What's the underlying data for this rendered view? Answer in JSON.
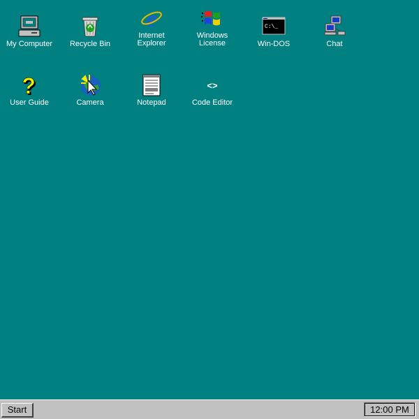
{
  "desktop": {
    "background": "#008080",
    "icons": [
      {
        "label": "My Computer",
        "icon": "computer-icon"
      },
      {
        "label": "Recycle Bin",
        "icon": "recycle-bin-icon"
      },
      {
        "label": "Internet\nExplorer",
        "icon": "internet-explorer-icon"
      },
      {
        "label": "Windows\nLicense",
        "icon": "windows-logo-icon"
      },
      {
        "label": "Win-DOS",
        "icon": "dos-prompt-icon"
      },
      {
        "label": "Chat",
        "icon": "network-computers-icon"
      },
      {
        "label": "User Guide",
        "icon": "question-mark-icon"
      },
      {
        "label": "Camera",
        "icon": "camera-icon"
      },
      {
        "label": "Notepad",
        "icon": "notepad-icon"
      },
      {
        "label": "Code Editor",
        "icon": "code-brackets-icon"
      }
    ],
    "dos_prompt_text": "C:\\_",
    "code_glyph": "<>"
  },
  "taskbar": {
    "start_label": "Start",
    "clock": "12:00 PM"
  }
}
